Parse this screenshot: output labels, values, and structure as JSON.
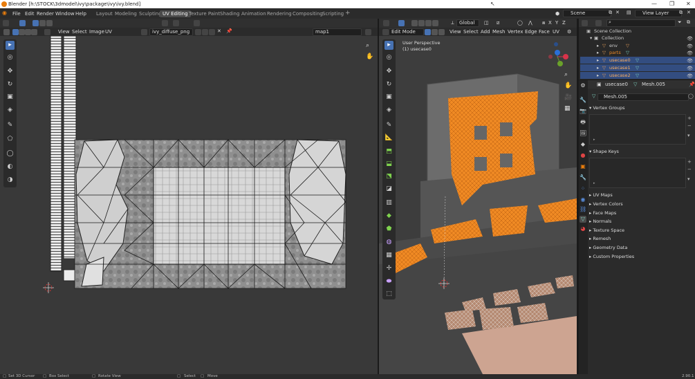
{
  "window": {
    "title": "Blender [h:\\STOCK\\3dmodel\\ivy\\package\\ivy\\ivy.blend]"
  },
  "menu": {
    "file": "File",
    "edit": "Edit",
    "render": "Render",
    "window": "Window",
    "help": "Help"
  },
  "workspaces": [
    "Layout",
    "Modeling",
    "Sculpting",
    "UV Editing",
    "Texture Paint",
    "Shading",
    "Animation",
    "Rendering",
    "Compositing",
    "Scripting"
  ],
  "active_workspace": "UV Editing",
  "top": {
    "scene": "Scene",
    "view_layer": "View Layer",
    "add_tab": "+"
  },
  "uv_editor": {
    "menus": {
      "view": "View",
      "select": "Select",
      "image": "Image",
      "uv": "UV"
    },
    "image_name": "ivy_diffuse_png",
    "uv_map": "map1"
  },
  "viewport": {
    "mode": "Edit Mode",
    "menus": {
      "view": "View",
      "select": "Select",
      "add": "Add",
      "mesh": "Mesh",
      "vertex": "Vertex",
      "edge": "Edge",
      "face": "Face",
      "uv": "UV"
    },
    "transform": "Global",
    "overlay_line1": "User Perspective",
    "overlay_line2": "(1) usecase0",
    "axes": {
      "x": "X",
      "y": "Y",
      "z": "Z"
    },
    "colors": {
      "selection": "#ff7f1a",
      "background": "#3d3d3d"
    }
  },
  "outliner": {
    "root": "Scene Collection",
    "collection": "Collection",
    "items": [
      {
        "label": "env",
        "selected": false
      },
      {
        "label": "parts",
        "selected": false
      },
      {
        "label": "usecase0",
        "selected": true
      },
      {
        "label": "usecase1",
        "selected": true
      },
      {
        "label": "usecase2",
        "selected": true
      }
    ]
  },
  "properties": {
    "object_name": "usecase0",
    "mesh_name": "Mesh.005",
    "datablock": "Mesh.005",
    "panels_open": [
      "Vertex Groups",
      "Shape Keys"
    ],
    "panels_closed": [
      "UV Maps",
      "Vertex Colors",
      "Face Maps",
      "Normals",
      "Texture Space",
      "Remesh",
      "Geometry Data",
      "Custom Properties"
    ]
  },
  "status": {
    "set_cursor": "Set 3D Cursor",
    "box_select": "Box Select",
    "rotate_view": "Rotate View",
    "select": "Select",
    "move": "Move",
    "version": "2.90.1"
  }
}
